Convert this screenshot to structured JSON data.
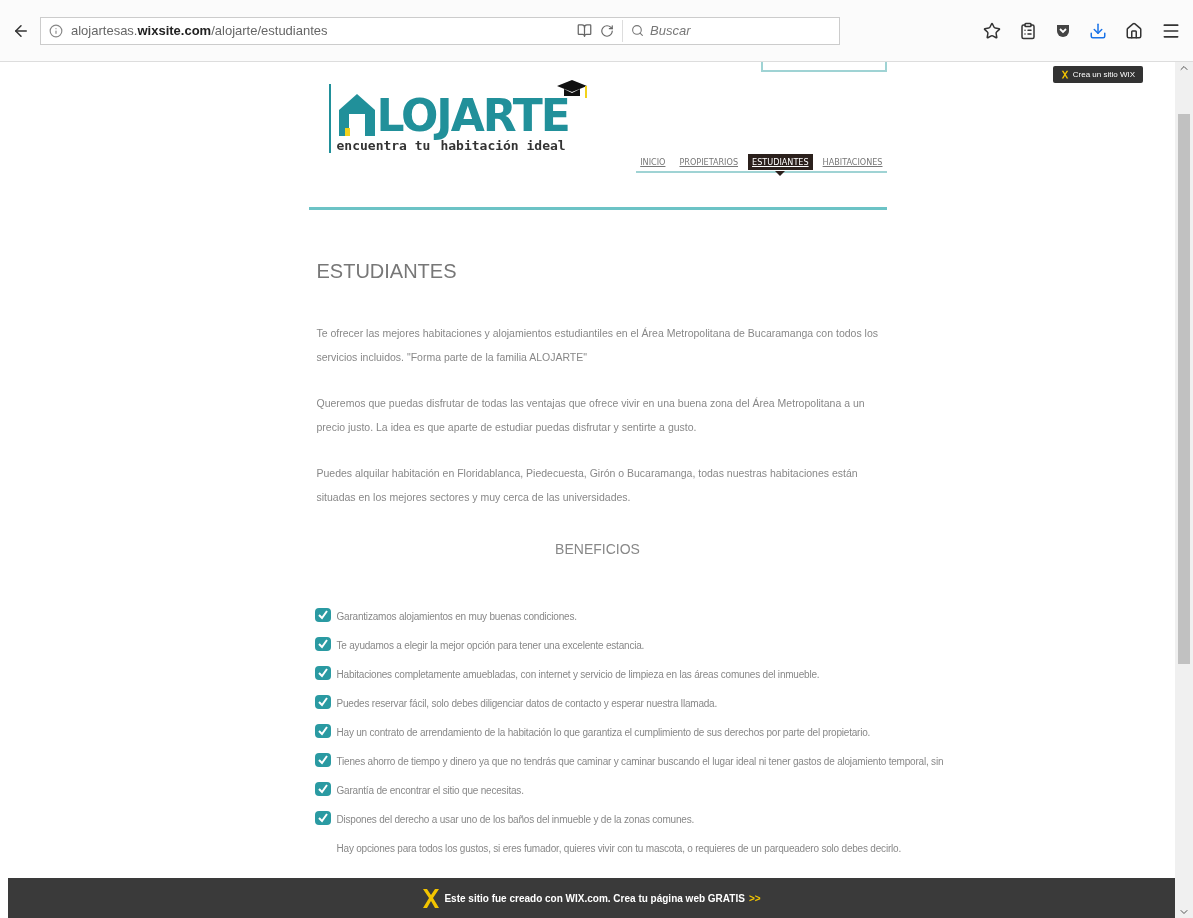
{
  "browser": {
    "url": "alojartesas.**wixsite.com**/alojarte/estudiantes",
    "search": {
      "placeholder": "Buscar"
    }
  },
  "wix_badge": "Crea un sitio WIX",
  "logo": {
    "name": "LOJARTE",
    "tagline_1": "encuentra tu",
    "tagline_2": "habitación ideal"
  },
  "nav": [
    {
      "label": "INICIO",
      "selected": false
    },
    {
      "label": "PROPIETARIOS",
      "selected": false
    },
    {
      "label": "ESTUDIANTES",
      "selected": true
    },
    {
      "label": "HABITACIONES",
      "selected": false
    }
  ],
  "title": "ESTUDIANTES",
  "paragraphs": [
    "Te ofrecer las mejores habitaciones y alojamientos estudiantiles en el Área Metropolitana de Bucaramanga con todos los servicios incluidos. \"Forma parte de la familia ALOJARTE\"",
    "Queremos que puedas disfrutar de todas las ventajas que ofrece vivir en una buena zona del Área Metropolitana a un precio justo. La idea es que aparte de estudiar puedas disfrutar y sentirte a gusto.",
    "Puedes alquilar habitación en Floridablanca, Piedecuesta, Girón o Bucaramanga, todas nuestras habitaciones están situadas en los mejores sectores y muy cerca de las universidades."
  ],
  "benefits_title": "BENEFICIOS",
  "benefits": [
    {
      "kind": "check",
      "text": "Garantizamos alojamientos en muy buenas condiciones."
    },
    {
      "kind": "check",
      "text": "Te ayudamos a elegir la mejor opción para tener una excelente estancia."
    },
    {
      "kind": "check",
      "text": "Habitaciones completamente amuebladas, con internet  y servicio de limpieza en las áreas comunes del inmueble."
    },
    {
      "kind": "check",
      "text": "Puedes reservar fácil, solo debes diligenciar datos de contacto y esperar nuestra llamada."
    },
    {
      "kind": "check",
      "text": "Hay un contrato de arrendamiento de la habitación lo que garantiza el cumplimiento de sus derechos por parte del propietario."
    },
    {
      "kind": "check",
      "text": "Tienes ahorro de tiempo y dinero ya que no tendrás que caminar y caminar buscando el lugar ideal ni tener gastos de alojamiento temporal, sin"
    },
    {
      "kind": "check",
      "text": "Garantía de encontrar el sitio que necesitas."
    },
    {
      "kind": "check",
      "text": "Dispones del derecho a usar uno de los baños del inmueble y  de la zonas comunes."
    },
    {
      "kind": "plain",
      "text": "Hay opciones para todos los gustos, si eres fumador, quieres vivir con tu mascota,  o requieres de un parqueadero solo debes decirlo."
    }
  ],
  "footer_banner": {
    "text": "Este sitio fue creado con WIX.com. Crea tu página web GRATIS",
    "arrows": ">>"
  }
}
